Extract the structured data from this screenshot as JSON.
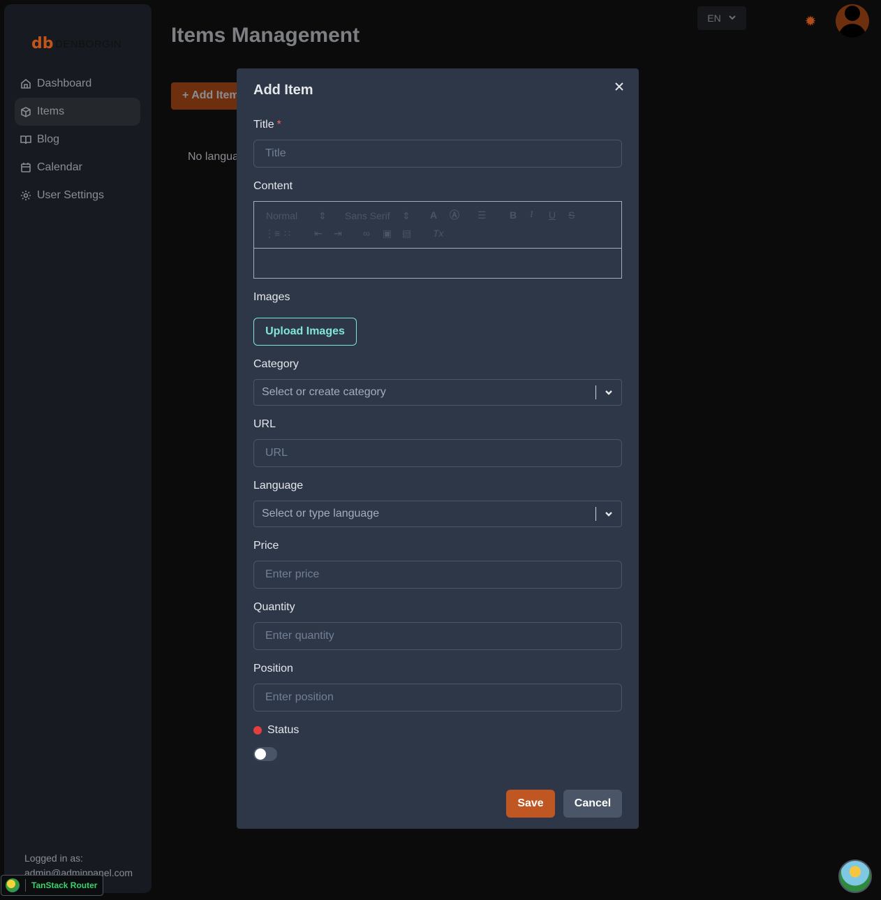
{
  "brand": {
    "name": "DENBORGIN"
  },
  "sidebar": {
    "items": [
      {
        "label": "Dashboard",
        "icon": "home-icon"
      },
      {
        "label": "Items",
        "icon": "box-icon"
      },
      {
        "label": "Blog",
        "icon": "book-icon"
      },
      {
        "label": "Calendar",
        "icon": "calendar-icon"
      },
      {
        "label": "User Settings",
        "icon": "gear-icon"
      }
    ],
    "active": "Items",
    "logged_in_label": "Logged in as:",
    "logged_in_email": "admin@adminpanel.com"
  },
  "header": {
    "page_title": "Items Management",
    "language": "EN",
    "theme_icon": "sun-icon"
  },
  "main": {
    "add_button_label": "+ Add Item",
    "empty_text": "No languages"
  },
  "devtools": {
    "label": "TanStack Router"
  },
  "modal": {
    "title": "Add Item",
    "fields": {
      "title": {
        "label": "Title",
        "placeholder": "Title",
        "required": "*"
      },
      "content": {
        "label": "Content",
        "font_size": "Normal",
        "font_family": "Sans Serif"
      },
      "images": {
        "label": "Images",
        "button": "Upload Images"
      },
      "category": {
        "label": "Category",
        "placeholder": "Select or create category"
      },
      "url": {
        "label": "URL",
        "placeholder": "URL"
      },
      "language": {
        "label": "Language",
        "placeholder": "Select or type language"
      },
      "price": {
        "label": "Price",
        "placeholder": "Enter price"
      },
      "quantity": {
        "label": "Quantity",
        "placeholder": "Enter quantity"
      },
      "position": {
        "label": "Position",
        "placeholder": "Enter position"
      },
      "status": {
        "label": "Status",
        "enabled": false
      }
    },
    "save_label": "Save",
    "cancel_label": "Cancel"
  },
  "colors": {
    "accent": "#c05621",
    "modal_bg": "#2d3748",
    "upload_accent": "#81e6d9",
    "status_off": "#e53e3e"
  }
}
